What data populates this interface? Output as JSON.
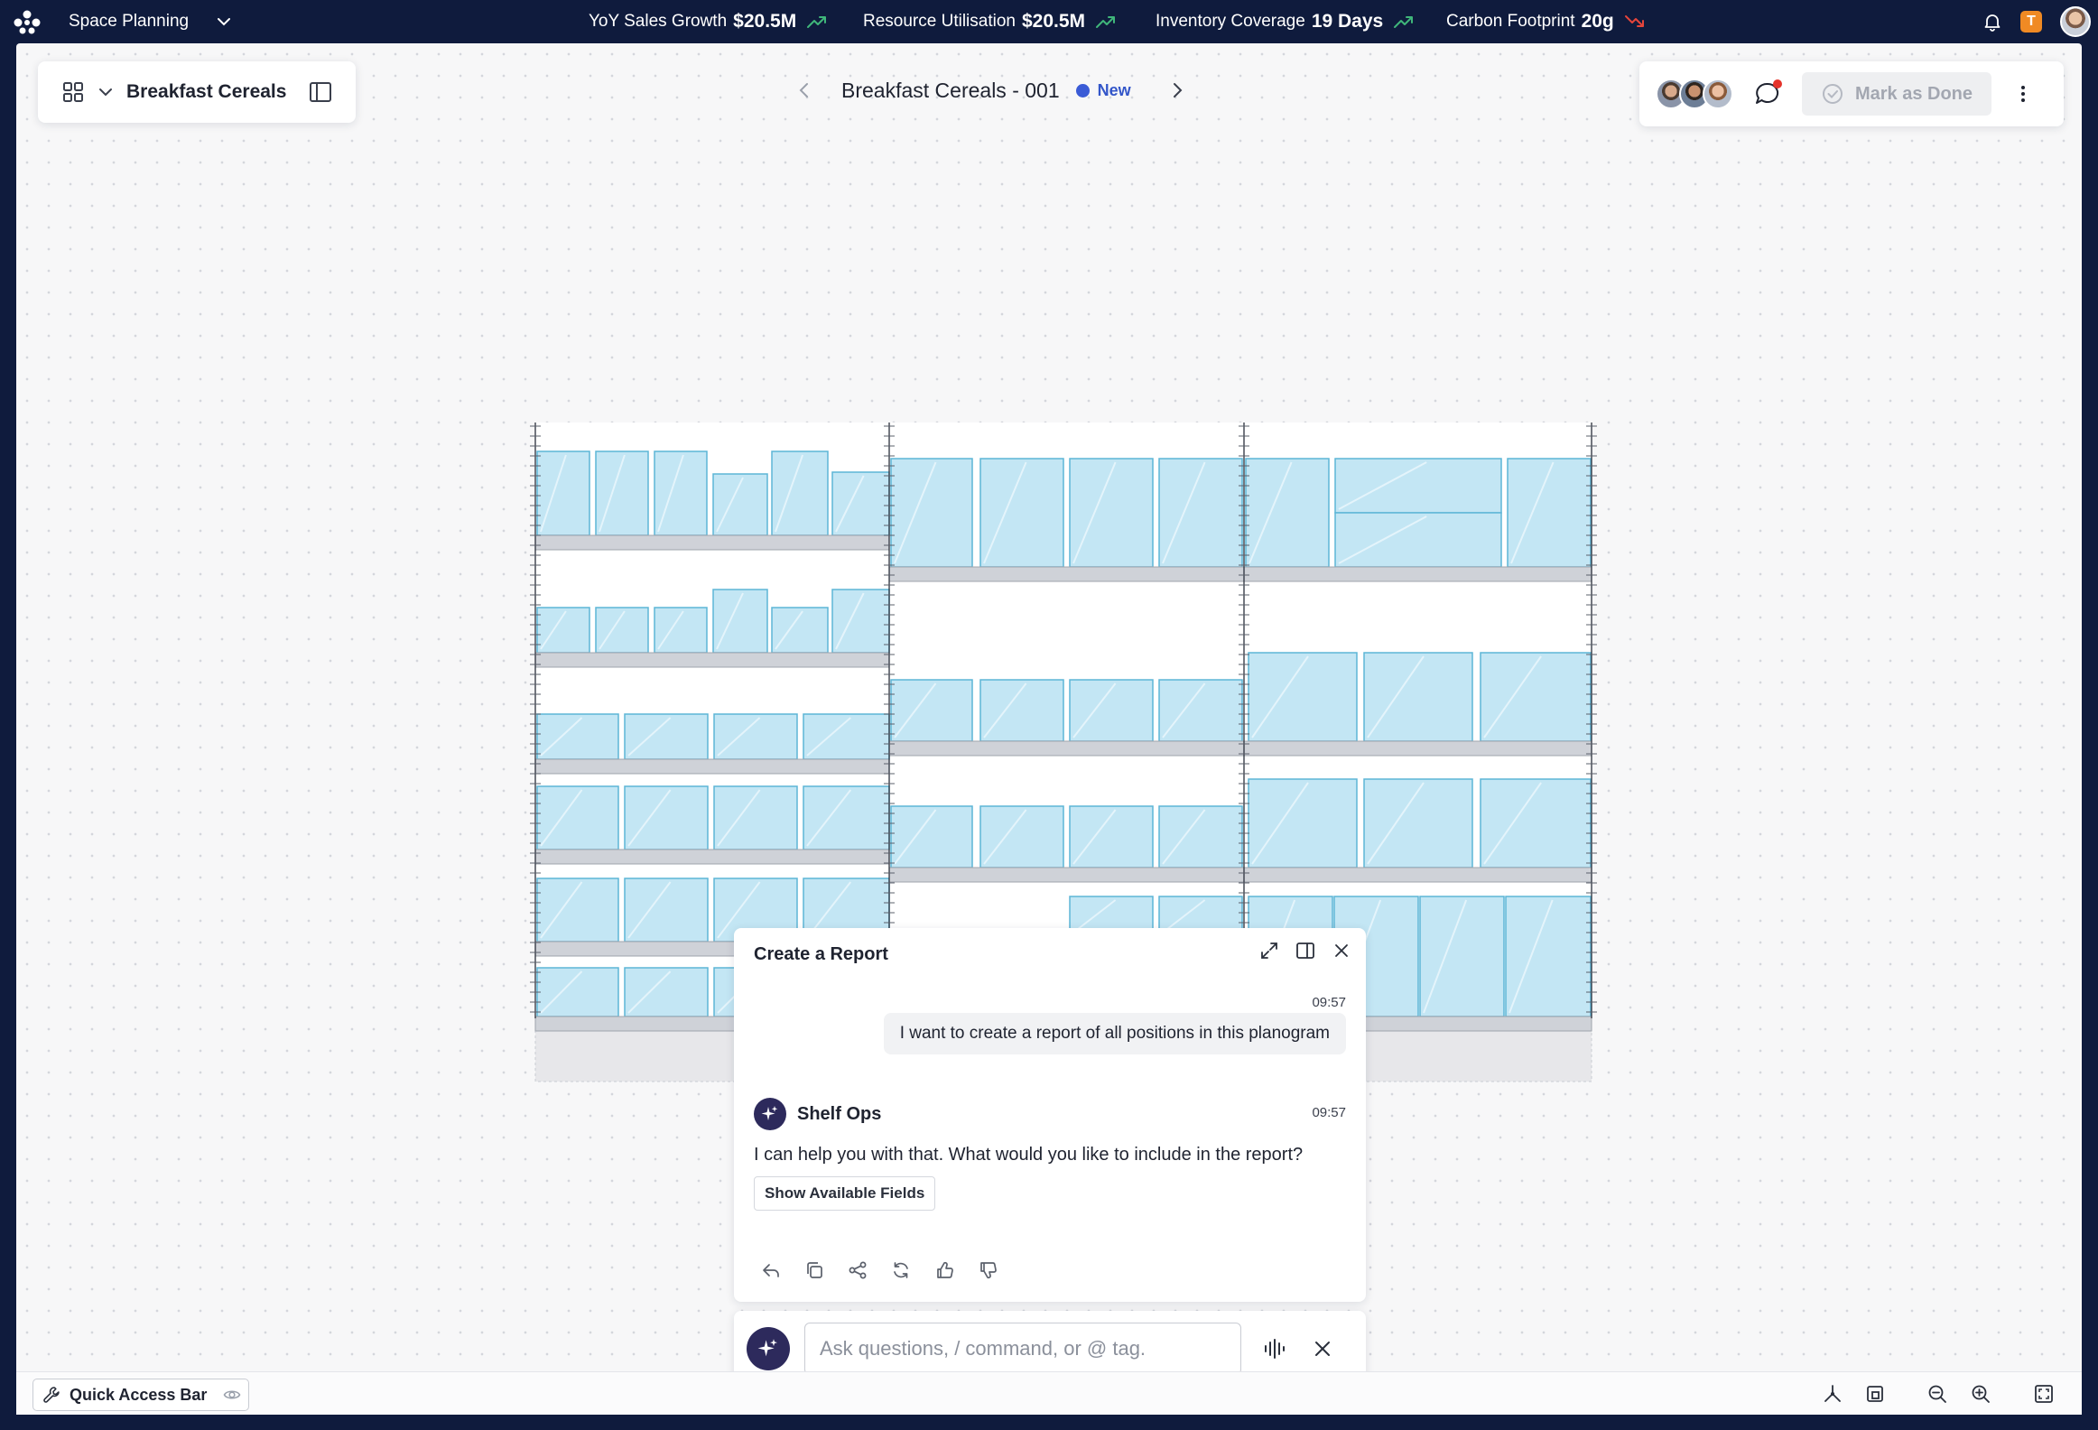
{
  "topbar": {
    "app_name": "Space Planning",
    "kpis": [
      {
        "label": "YoY Sales Growth",
        "value": "$20.5M",
        "trend": "up"
      },
      {
        "label": "Resource Utilisation",
        "value": "$20.5M",
        "trend": "up"
      },
      {
        "label": "Inventory Coverage",
        "value": "19 Days",
        "trend": "up"
      },
      {
        "label": "Carbon Footprint",
        "value": "20g",
        "trend": "down"
      }
    ],
    "user_badge": "T",
    "colors": {
      "trend_up": "#3fb67a",
      "trend_down": "#e5453b"
    }
  },
  "header": {
    "category": "Breakfast Cereals",
    "doc_title": "Breakfast Cereals - 001",
    "status": "New",
    "mark_done_label": "Mark as Done"
  },
  "chat": {
    "title": "Create a Report",
    "user_message": {
      "time": "09:57",
      "text": "I want to create a report of all positions in this planogram"
    },
    "bot": {
      "name": "Shelf Ops",
      "time": "09:57",
      "text": "I can help you with that. What would you like to include in the report?"
    },
    "button_label": "Show Available Fields",
    "input_placeholder": "Ask questions, / command, or @ tag."
  },
  "bottombar": {
    "quick_access_label": "Quick Access Bar"
  },
  "icons": [
    "app-logo-icon",
    "chevron-down-icon",
    "trend-up-icon",
    "trend-down-icon",
    "bell-icon",
    "grid-icon",
    "panel-icon",
    "chevron-left-icon",
    "chevron-right-icon",
    "comment-icon",
    "check-circle-icon",
    "more-vertical-icon",
    "expand-icon",
    "split-panel-icon",
    "close-icon",
    "sparkle-icon",
    "reply-icon",
    "copy-icon",
    "share-icon",
    "refresh-icon",
    "thumbs-up-icon",
    "thumbs-down-icon",
    "voice-icon",
    "wrench-icon",
    "eye-icon",
    "hierarchy-icon",
    "layout-icon",
    "zoom-out-icon",
    "zoom-in-icon",
    "fit-screen-icon"
  ],
  "colors": {
    "accent": "#2d2a5c",
    "status_new": "#3a5bd6",
    "product_fill": "#c3e6f4",
    "product_stroke": "#5db5d6",
    "shelf": "#cfd2d8",
    "topbar_bg": "#0f1b3d"
  }
}
